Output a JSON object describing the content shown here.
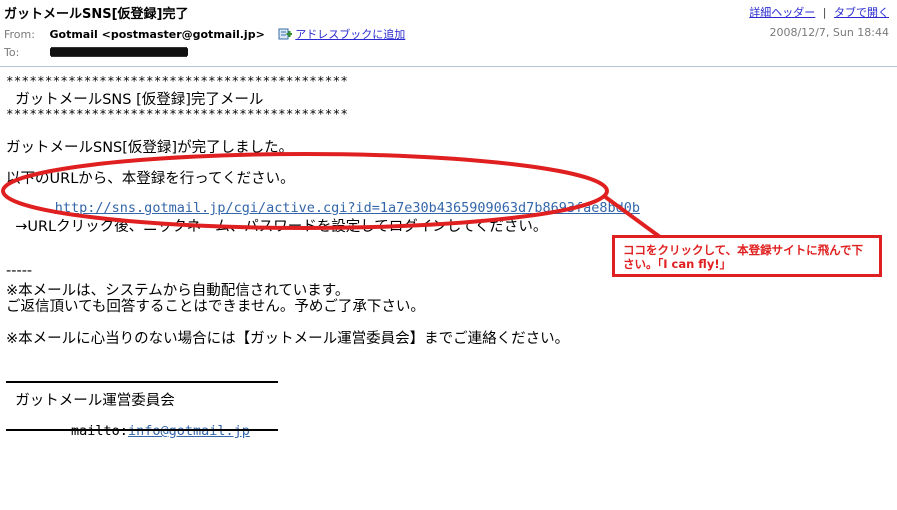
{
  "header": {
    "subject": "ガットメールSNS[仮登録]完了",
    "links": {
      "detail_header": "詳細ヘッダー",
      "separator": "|",
      "open_in_tab": "タブで開く"
    },
    "from_label": "From:",
    "from_sender": "Gotmail <postmaster@gotmail.jp>",
    "add_to_addressbook": "アドレスブックに追加",
    "date": "2008/12/7, Sun 18:44",
    "to_label": "To:"
  },
  "body": {
    "stars_top": "********************************************",
    "banner_title": "  ガットメールSNS [仮登録]完了メール",
    "stars_bottom": "********************************************",
    "completed_line": "ガットメールSNS[仮登録]が完了しました。",
    "instruction_line": "以下のURLから、本登録を行ってください。",
    "activation_url": "http://sns.gotmail.jp/cgi/active.cgi?id=1a7e30b4365909063d7b8693fae8bd0b",
    "after_click_line": "  →URLクリック後、ニックネーム、パスワードを設定してログインしてください。",
    "divider": "-----",
    "auto_notice": "※本メールは、システムから自動配信されています。",
    "no_reply_notice": "ご返信頂いても回答することはできません。予めご了承下さい。",
    "contact_notice": "※本メールに心当りのない場合には【ガットメール運営委員会】までご連絡ください。",
    "signature_org": "  ガットメール運営委員会",
    "signature_mailto_prefix": "  mailto:",
    "signature_email": "info@gotmail.jp"
  },
  "annotation": {
    "callout_text": "ココをクリックして、本登録サイトに飛んで下さい。「I can fly!」",
    "color": "#e02020"
  }
}
